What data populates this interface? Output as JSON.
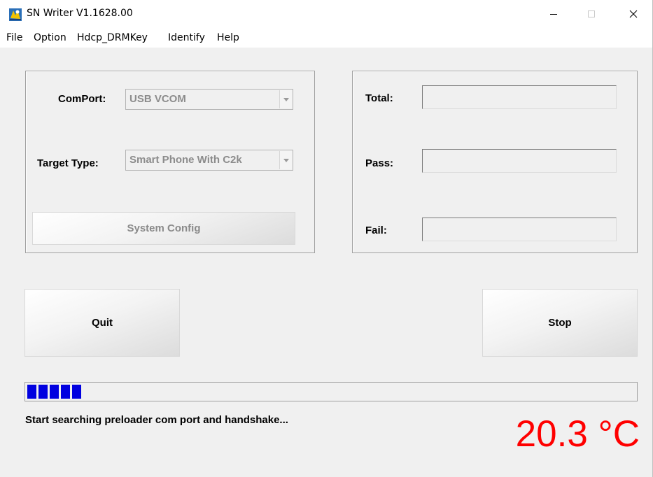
{
  "window": {
    "title": "SN Writer V1.1628.00",
    "minimize_glyph": "—",
    "maximize_glyph": "☐",
    "close_glyph": "✕"
  },
  "menu": {
    "items": [
      "File",
      "Option",
      "Hdcp_DRMKey",
      "Identify",
      "Help"
    ]
  },
  "config": {
    "comport_label": "ComPort:",
    "comport_value": "USB VCOM",
    "target_label": "Target Type:",
    "target_value": "Smart Phone With C2k",
    "system_config_label": "System Config"
  },
  "stats": {
    "total_label": "Total:",
    "total_value": "",
    "pass_label": "Pass:",
    "pass_value": "",
    "fail_label": "Fail:",
    "fail_value": ""
  },
  "actions": {
    "quit_label": "Quit",
    "stop_label": "Stop"
  },
  "progress": {
    "segments_filled": 5
  },
  "status": {
    "message": "Start searching preloader com port and handshake...",
    "temperature": "20.3 °C",
    "temperature_color": "#ff0000"
  },
  "icons": {
    "app": "app-logo-icon",
    "dropdown": "dropdown-arrow-icon"
  }
}
